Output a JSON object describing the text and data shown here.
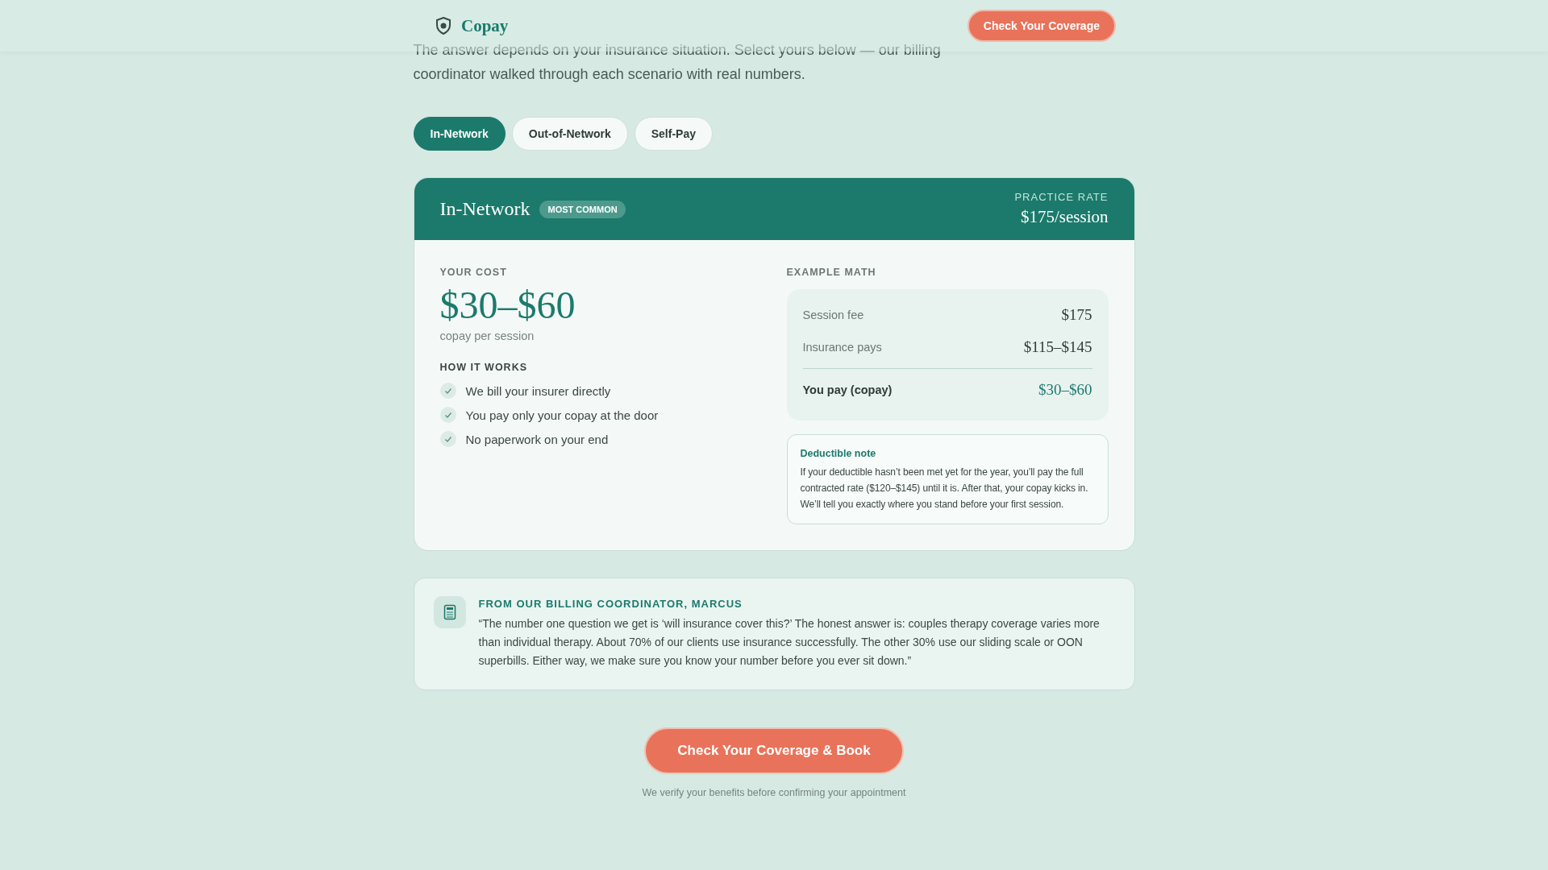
{
  "header": {
    "brand": "Copay",
    "cta": "Check Your Coverage"
  },
  "intro": "The answer depends on your insurance situation. Select yours below — our billing coordinator walked through each scenario with real numbers.",
  "tabs": [
    {
      "label": "In-Network",
      "selected": true
    },
    {
      "label": "Out-of-Network",
      "selected": false
    },
    {
      "label": "Self-Pay",
      "selected": false
    }
  ],
  "plan": {
    "title": "In-Network",
    "badge": "MOST COMMON",
    "rate_label": "PRACTICE RATE",
    "rate": "$175/session",
    "cost_label": "YOUR COST",
    "cost": "$30–$60",
    "cost_note": "copay per session",
    "how_label": "HOW IT WORKS",
    "steps": [
      "We bill your insurer directly",
      "You pay only your copay at the door",
      "No paperwork on your end"
    ],
    "math_label": "EXAMPLE MATH",
    "math": [
      {
        "label": "Session fee",
        "value": "$175",
        "kind": "line"
      },
      {
        "label": "Insurance pays",
        "value": "$115–$145",
        "kind": "line"
      },
      {
        "label": "You pay (copay)",
        "value": "$30–$60",
        "kind": "total"
      }
    ],
    "note_title": "Deductible note",
    "note": "If your deductible hasn’t been met yet for the year, you’ll pay the full contracted rate ($120–$145) until it is. After that, your copay kicks in. We’ll tell you exactly where you stand before your first session."
  },
  "quote": {
    "heading": "FROM OUR BILLING COORDINATOR, MARCUS",
    "text": "“The number one question we get is ‘will insurance cover this?’ The honest answer is: couples therapy coverage varies more than individual therapy. About 70% of our clients use insurance successfully. The other 30% use our sliding scale or OON superbills. Either way, we make sure you know your number before you ever sit down.”"
  },
  "cta": {
    "label": "Check Your Coverage & Book",
    "note": "We verify your benefits before confirming your appointment"
  }
}
